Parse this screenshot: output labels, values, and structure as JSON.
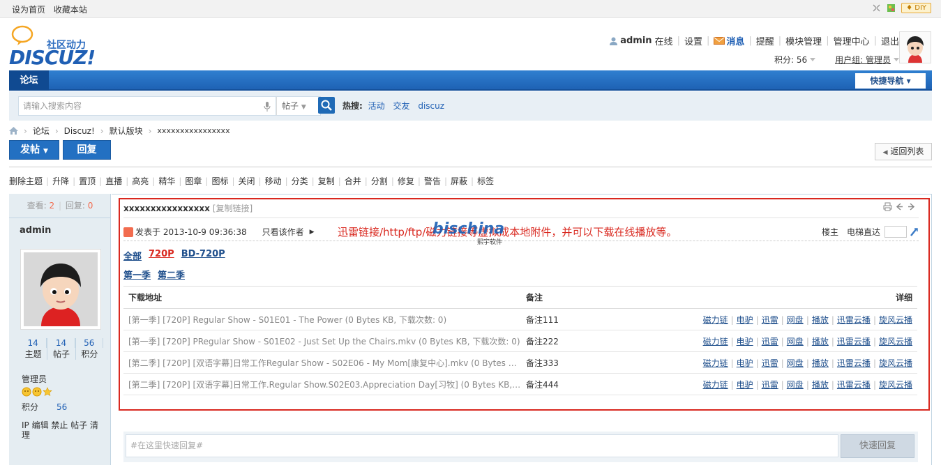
{
  "topbar": {
    "set_home": "设为首页",
    "bookmark": "收藏本站",
    "diy": "♦ DIY"
  },
  "logo": {
    "cn": "社区动力",
    "en": "DISCUZ!"
  },
  "user": {
    "name": "admin",
    "online": "在线",
    "settings": "设置",
    "messages": "消息",
    "remind": "提醒",
    "modules": "模块管理",
    "admin_center": "管理中心",
    "logout": "退出",
    "points": "积分: 56",
    "group": "用户组: 管理员"
  },
  "nav": {
    "forum_tab": "论坛",
    "quick_nav": "快捷导航"
  },
  "search": {
    "placeholder": "请输入搜索内容",
    "type": "帖子",
    "hot_label": "热搜:",
    "hot": [
      "活动",
      "交友",
      "discuz"
    ]
  },
  "breadcrumb": [
    "论坛",
    "Discuz!",
    "默认版块",
    "xxxxxxxxxxxxxxxx"
  ],
  "buttons": {
    "post": "发帖",
    "reply": "回复",
    "back": "返回列表"
  },
  "mod_actions": [
    "删除主题",
    "升降",
    "置顶",
    "直播",
    "高亮",
    "精华",
    "图章",
    "图标",
    "关闭",
    "移动",
    "分类",
    "复制",
    "合并",
    "分割",
    "修复",
    "警告",
    "屏蔽",
    "标签"
  ],
  "sidebar": {
    "views_label": "查看:",
    "views": "2",
    "replies_label": "回复:",
    "replies": "0",
    "username": "admin",
    "stats": [
      {
        "n": "14",
        "l": "主题"
      },
      {
        "n": "14",
        "l": "帖子"
      },
      {
        "n": "56",
        "l": "积分"
      }
    ],
    "group": "管理员",
    "points_label": "积分",
    "points": "56",
    "ops": "IP 编辑 禁止 帖子 清理"
  },
  "post": {
    "title": "xxxxxxxxxxxxxxxx",
    "copy_link": "[复制链接]",
    "posted": "发表于 2013-10-9 09:36:38",
    "only_author": "只看该作者",
    "notice": "迅雷链接/http/ftp/磁力链接等虚拟成本地附件，并可以下载在线播放等。",
    "watermark_top": "bischina",
    "watermark_sub": "熙宇软件",
    "floor": "楼主",
    "elevator": "电梯直达"
  },
  "tabs_quality": [
    "全部",
    "720P",
    "BD-720P"
  ],
  "tabs_season": [
    "第一季",
    "第二季"
  ],
  "table": {
    "headers": [
      "下载地址",
      "备注",
      "详细"
    ],
    "rows": [
      {
        "name": "[第一季] [720P] Regular Show - S01E01 - The Power (0 Bytes KB, 下载次数: 0)",
        "note": "备注111"
      },
      {
        "name": "[第一季] [720P] PRegular Show - S01E02 - Just Set Up the Chairs.mkv (0 Bytes KB, 下载次数: 0)",
        "note": "备注222"
      },
      {
        "name": "[第二季] [720P] [双语字幕]日常工作Regular Show - S02E06 - My Mom[康复中心].mkv (0 Bytes KB...",
        "note": "备注333"
      },
      {
        "name": "[第二季] [720P] [双语字幕]日常工作.Regular Show.S02E03.Appreciation Day[习牧] (0 Bytes KB, ...",
        "note": "备注444"
      }
    ],
    "actions": [
      "磁力链",
      "电驴",
      "迅雷",
      "网盘",
      "播放",
      "迅雷云播",
      "旋风云播"
    ]
  },
  "quick_reply": {
    "placeholder": "#在这里快速回复#",
    "button": "快速回复"
  }
}
